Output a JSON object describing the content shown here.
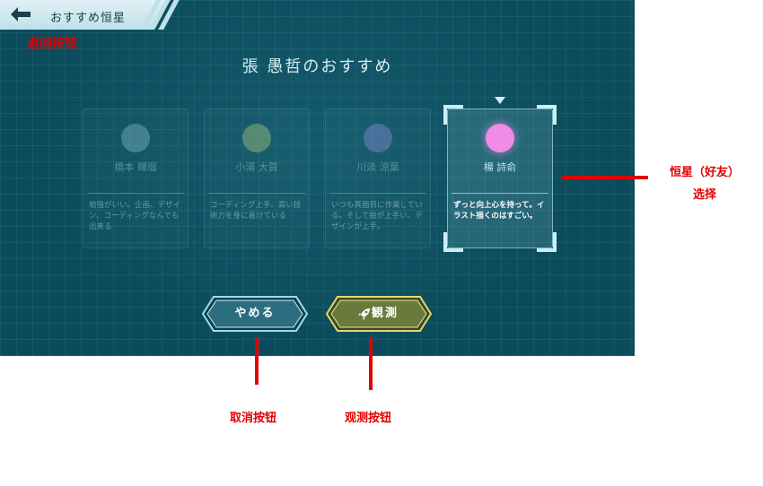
{
  "header": {
    "back_icon": "arrow-left-icon",
    "title": "おすすめ恒星"
  },
  "page_title": "張 愚哲のおすすめ",
  "cards": [
    {
      "name": "橋本 輝瑠",
      "desc": "勉強がいい。企画、デザイン、コーディングなんでも出来る",
      "planet_color": "#7fb9c9",
      "selected": false
    },
    {
      "name": "小湯 大賀",
      "desc": "コーディング上手。高い技術力を身に着けている",
      "planet_color": "#a7c77e",
      "selected": false
    },
    {
      "name": "川淡 涼葉",
      "desc": "いつも真面目に作業している。そして絵が上手い、デザインが上手。",
      "planet_color": "#8c8fd6",
      "selected": false
    },
    {
      "name": "楊 詩俞",
      "desc": "ずっと向上心を持って。イラスト描くのはすごい。",
      "planet_color": "#f08be8",
      "selected": true
    }
  ],
  "buttons": {
    "cancel": {
      "label": "やめる",
      "border_color": "#9fdcea"
    },
    "observe": {
      "label": "観測",
      "icon": "rocket-icon",
      "border_color": "#e6d86a"
    }
  },
  "annotations": {
    "back": "返回按钮",
    "star_select_line1": "恒星（好友）",
    "star_select_line2": "选择",
    "cancel": "取消按钮",
    "observe": "观测按钮"
  }
}
